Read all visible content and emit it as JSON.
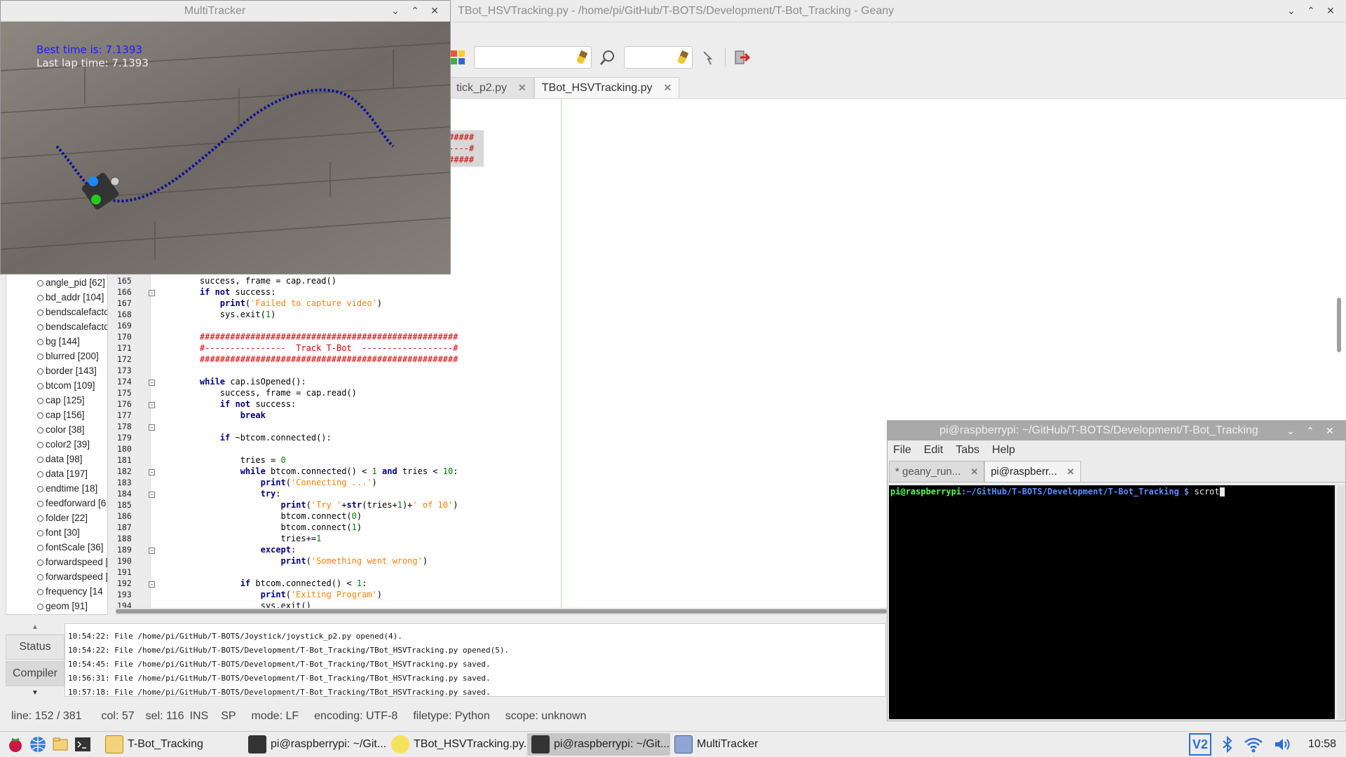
{
  "geany": {
    "title": "TBot_HSVTracking.py - /home/pi/GitHub/T-BOTS/Development/T-Bot_Tracking - Geany",
    "tabs": [
      {
        "label": "tick_p2.py"
      },
      {
        "label": "TBot_HSVTracking.py"
      }
    ],
    "symbols": [
      "angle_pid [62]",
      "bd_addr [104]",
      "bendscalefacto",
      "bendscalefacto",
      "bg [144]",
      "blurred [200]",
      "border [143]",
      "btcom [109]",
      "cap [125]",
      "cap [156]",
      "color [38]",
      "color2 [39]",
      "data [98]",
      "data [197]",
      "endtime [18]",
      "feedforward [6",
      "folder [22]",
      "font [30]",
      "fontScale [36]",
      "forwardspeed [",
      "forwardspeed [",
      "frequency [14",
      "geom [91]"
    ],
    "line_numbers": [
      "165",
      "166",
      "167",
      "168",
      "169",
      "170",
      "171",
      "172",
      "173",
      "174",
      "175",
      "176",
      "177",
      "178",
      "179",
      "180",
      "181",
      "182",
      "183",
      "184",
      "185",
      "186",
      "187",
      "188",
      "189",
      "190",
      "191",
      "192",
      "193",
      "194"
    ],
    "hash_fragments": [
      "#####",
      "----#",
      "#####"
    ],
    "messages": [
      "10:54:22: File /home/pi/GitHub/T-BOTS/Joystick/joystick_p2.py opened(4).",
      "10:54:22: File /home/pi/GitHub/T-BOTS/Development/T-Bot_Tracking/TBot_HSVTracking.py opened(5).",
      "10:54:45: File /home/pi/GitHub/T-BOTS/Development/T-Bot_Tracking/TBot_HSVTracking.py saved.",
      "10:56:31: File /home/pi/GitHub/T-BOTS/Development/T-Bot_Tracking/TBot_HSVTracking.py saved.",
      "10:57:18: File /home/pi/GitHub/T-BOTS/Development/T-Bot_Tracking/TBot_HSVTracking.py saved."
    ],
    "msg_tabs": [
      "Status",
      "Compiler"
    ],
    "status": {
      "line": "line: 152 / 381",
      "col": "col: 57",
      "sel": "sel: 116",
      "ins": "INS",
      "sp": "SP",
      "mode": "mode: LF",
      "encoding": "encoding: UTF-8",
      "filetype": "filetype: Python",
      "scope": "scope: unknown"
    }
  },
  "tracker": {
    "title": "MultiTracker",
    "best": "Best time is: 7.1393",
    "last": "Last lap time: 7.1393"
  },
  "terminal": {
    "title": "pi@raspberrypi: ~/GitHub/T-BOTS/Development/T-Bot_Tracking",
    "menu": [
      "File",
      "Edit",
      "Tabs",
      "Help"
    ],
    "tabs": [
      "* geany_run...",
      "pi@raspberr..."
    ],
    "prompt_user": "pi@raspberrypi",
    "prompt_path": ":~/GitHub/T-BOTS/Development/T-Bot_Tracking $ ",
    "command": "scrot"
  },
  "taskbar": {
    "windows": [
      {
        "label": "T-Bot_Tracking"
      },
      {
        "label": "pi@raspberrypi: ~/Git..."
      },
      {
        "label": "TBot_HSVTracking.py..."
      },
      {
        "label": "pi@raspberrypi: ~/Git..."
      },
      {
        "label": "MultiTracker"
      }
    ],
    "clock": "10:58"
  },
  "colors": {
    "keyword": "#00007f",
    "string": "#ff8000",
    "number": "#007f00",
    "comment": "#d00000",
    "tracker_text": "#1a1aff"
  }
}
